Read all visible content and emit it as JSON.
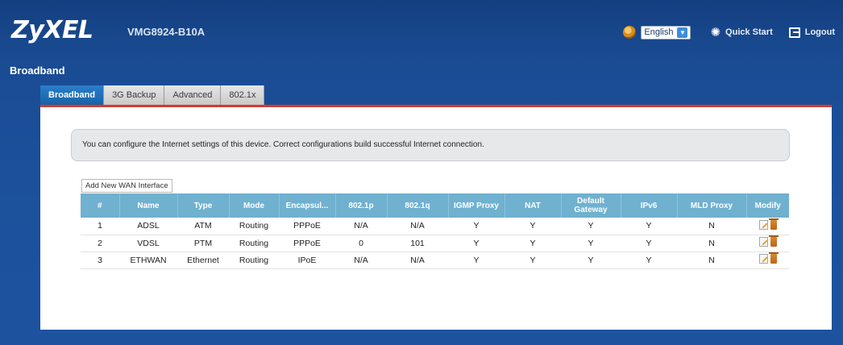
{
  "header": {
    "logo": "ZyXEL",
    "model": "VMG8924-B10A",
    "language": "English",
    "quick_start": "Quick Start",
    "logout": "Logout"
  },
  "page": {
    "title": "Broadband"
  },
  "tabs": [
    {
      "label": "Broadband",
      "active": true
    },
    {
      "label": "3G Backup",
      "active": false
    },
    {
      "label": "Advanced",
      "active": false
    },
    {
      "label": "802.1x",
      "active": false
    }
  ],
  "info_text": "You can configure the Internet settings of this device. Correct configurations build successful Internet connection.",
  "add_button": "Add New WAN Interface",
  "table": {
    "headers": [
      "#",
      "Name",
      "Type",
      "Mode",
      "Encapsul...",
      "802.1p",
      "802.1q",
      "IGMP Proxy",
      "NAT",
      "Default Gateway",
      "IPv6",
      "MLD Proxy",
      "Modify"
    ],
    "rows": [
      [
        "1",
        "ADSL",
        "ATM",
        "Routing",
        "PPPoE",
        "N/A",
        "N/A",
        "Y",
        "Y",
        "Y",
        "Y",
        "N"
      ],
      [
        "2",
        "VDSL",
        "PTM",
        "Routing",
        "PPPoE",
        "0",
        "101",
        "Y",
        "Y",
        "Y",
        "Y",
        "N"
      ],
      [
        "3",
        "ETHWAN",
        "Ethernet",
        "Routing",
        "IPoE",
        "N/A",
        "N/A",
        "Y",
        "Y",
        "Y",
        "Y",
        "N"
      ]
    ]
  },
  "colors": {
    "background": "#1c519c",
    "active_tab": "#1762a8",
    "tab_underline": "#d33b2e",
    "table_header": "#6fb1cf"
  }
}
